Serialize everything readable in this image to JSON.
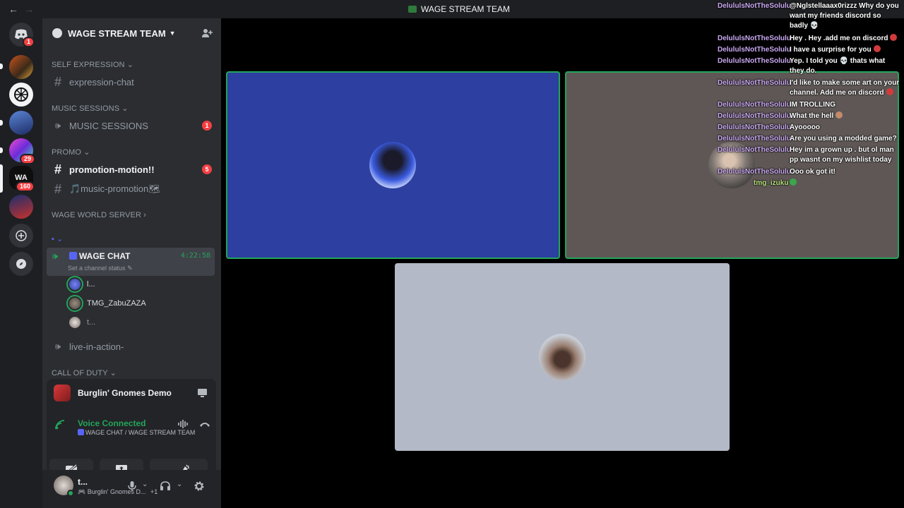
{
  "titlebar": {
    "title": "WAGE STREAM TEAM",
    "back": "←",
    "forward": "→"
  },
  "guilds": {
    "home_badge": "1",
    "badge_29": "29",
    "badge_160": "160",
    "wa_label": "WA"
  },
  "server": {
    "name": "WAGE STREAM TEAM",
    "categories": {
      "self_expression": "SELF EXPRESSION",
      "music_sessions": "MUSIC SESSIONS",
      "promo": "PROMO",
      "wage_world": "WAGE WORLD SERVER",
      "call_of_duty": "CALL OF DUTY"
    },
    "channels": {
      "expression_chat": "expression-chat",
      "music_sessions": "MUSIC SESSIONS",
      "music_sessions_badge": "1",
      "promotion_motion": "promotion-motion!!",
      "promotion_motion_badge": "5",
      "music_promotion": "🎵music-promotion🗺",
      "wage_chat": "WAGE CHAT",
      "wage_chat_time": "4:22:58",
      "wage_chat_status": "Set a channel status",
      "live_in_action": "live-in-action-"
    },
    "members": [
      "l...",
      "TMG_ZabuZAZA",
      "t..."
    ]
  },
  "activity": {
    "game": "Burglin' Gnomes Demo"
  },
  "voice": {
    "status": "Voice Connected",
    "location": "WAGE CHAT / WAGE STREAM TEAM"
  },
  "user": {
    "name": "t...",
    "activity": "Burglin' Gnomes D...",
    "extra": "+1"
  },
  "chat": [
    {
      "user": "DelululsNotTheSolulu",
      "text": "@Nglstellaaax0rizzz Why do you want my friends discord so badly 💀"
    },
    {
      "user": "DelululsNotTheSolulu",
      "text": "Hey . Hey .add me on discord"
    },
    {
      "user": "DelululsNotTheSolulu",
      "text": "I have a surprise for you"
    },
    {
      "user": "DelululsNotTheSolulu",
      "text": "Yep. I told you 💀 thats what they do."
    },
    {
      "user": "DelululsNotTheSolulu",
      "text": "I'd like to make some art on your channel. Add me on discord"
    },
    {
      "user": "DelululsNotTheSolulu",
      "text": "IM TROLLING"
    },
    {
      "user": "DelululsNotTheSolulu",
      "text": "What the hell"
    },
    {
      "user": "DelululsNotTheSolulu",
      "text": "Ayooooo"
    },
    {
      "user": "DelululsNotTheSolulu",
      "text": "Are you using a modded game?"
    },
    {
      "user": "DelululsNotTheSolulu",
      "text": "Hey im a grown up . but ol man pp wasnt on my wishlist today"
    },
    {
      "user": "DelululsNotTheSolulu",
      "text": "Ooo ok got it!"
    },
    {
      "user": "tmg_izuku",
      "text": ""
    }
  ],
  "colors": {
    "tile_blue": "#2d3fa0",
    "tile_brown": "#5e5756",
    "tile_gray": "#b3b9c6",
    "speaking_border": "#23a55a",
    "chat_username": "#c9a8f0"
  }
}
